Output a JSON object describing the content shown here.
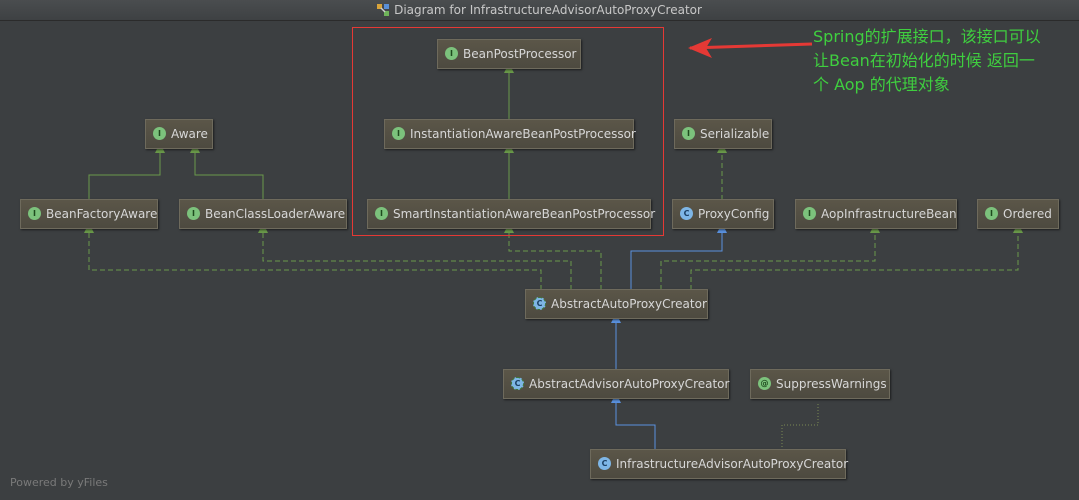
{
  "window": {
    "title": "Diagram for InfrastructureAdvisorAutoProxyCreator"
  },
  "colors": {
    "interface_edge": "#6a9a4a",
    "class_edge": "#5a92e0",
    "annotation_edge": "#7a8a52",
    "highlight_box": "#e53935",
    "annotation_text": "#3fcf3f"
  },
  "nodes": {
    "bean_post_processor": {
      "kind": "interface",
      "badge": "I",
      "label": "BeanPostProcessor"
    },
    "instantiation_aware_bpp": {
      "kind": "interface",
      "badge": "I",
      "label": "InstantiationAwareBeanPostProcessor"
    },
    "smart_instantiation_aware_bpp": {
      "kind": "interface",
      "badge": "I",
      "label": "SmartInstantiationAwareBeanPostProcessor"
    },
    "aware": {
      "kind": "interface",
      "badge": "I",
      "label": "Aware"
    },
    "bean_factory_aware": {
      "kind": "interface",
      "badge": "I",
      "label": "BeanFactoryAware"
    },
    "bean_class_loader_aware": {
      "kind": "interface",
      "badge": "I",
      "label": "BeanClassLoaderAware"
    },
    "serializable": {
      "kind": "interface",
      "badge": "I",
      "label": "Serializable"
    },
    "proxy_config": {
      "kind": "class",
      "badge": "C",
      "label": "ProxyConfig"
    },
    "aop_infrastructure_bean": {
      "kind": "interface",
      "badge": "I",
      "label": "AopInfrastructureBean"
    },
    "ordered": {
      "kind": "interface",
      "badge": "I",
      "label": "Ordered"
    },
    "abstract_auto_proxy_creator": {
      "kind": "abstract",
      "badge": "C",
      "label": "AbstractAutoProxyCreator"
    },
    "abstract_advisor_auto_proxy_creator": {
      "kind": "abstract",
      "badge": "C",
      "label": "AbstractAdvisorAutoProxyCreator"
    },
    "suppress_warnings": {
      "kind": "annotation",
      "badge": "@",
      "label": "SuppressWarnings"
    },
    "infrastructure_advisor_auto_proxy_creator": {
      "kind": "class",
      "badge": "C",
      "label": "InfrastructureAdvisorAutoProxyCreator"
    }
  },
  "annotation": {
    "lines": [
      "Spring的扩展接口，该接口可以",
      "让Bean在初始化的时候 返回一",
      "个 Aop 的代理对象"
    ]
  },
  "footer": "Powered by yFiles"
}
